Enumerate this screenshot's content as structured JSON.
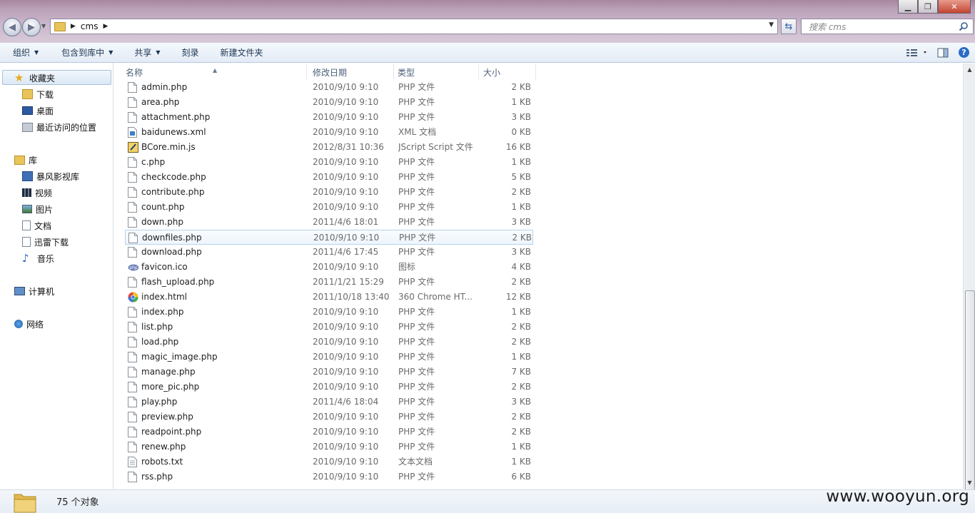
{
  "window": {
    "minimize": "▁",
    "maximize": "❐",
    "close": "✕"
  },
  "address": {
    "segment": "cms",
    "arrow": "▶"
  },
  "search": {
    "placeholder": "搜索 cms"
  },
  "toolbar": {
    "organize": "组织",
    "include_in_library": "包含到库中",
    "share": "共享",
    "burn": "刻录",
    "new_folder": "新建文件夹"
  },
  "nav": {
    "favorites": "收藏夹",
    "downloads": "下载",
    "desktop": "桌面",
    "recent": "最近访问的位置",
    "libraries": "库",
    "baofeng": "暴风影视库",
    "videos": "视频",
    "pictures": "图片",
    "documents": "文档",
    "xunlei": "迅雷下载",
    "music": "音乐",
    "computer": "计算机",
    "network": "网络"
  },
  "columns": {
    "name": "名称",
    "date": "修改日期",
    "type": "类型",
    "size": "大小"
  },
  "files": [
    {
      "name": "admin.php",
      "date": "2010/9/10 9:10",
      "type": "PHP 文件",
      "size": "2 KB",
      "icon": "php"
    },
    {
      "name": "area.php",
      "date": "2010/9/10 9:10",
      "type": "PHP 文件",
      "size": "1 KB",
      "icon": "php"
    },
    {
      "name": "attachment.php",
      "date": "2010/9/10 9:10",
      "type": "PHP 文件",
      "size": "3 KB",
      "icon": "php"
    },
    {
      "name": "baidunews.xml",
      "date": "2010/9/10 9:10",
      "type": "XML 文档",
      "size": "0 KB",
      "icon": "xml"
    },
    {
      "name": "BCore.min.js",
      "date": "2012/8/31 10:36",
      "type": "JScript Script 文件",
      "size": "16 KB",
      "icon": "js"
    },
    {
      "name": "c.php",
      "date": "2010/9/10 9:10",
      "type": "PHP 文件",
      "size": "1 KB",
      "icon": "php"
    },
    {
      "name": "checkcode.php",
      "date": "2010/9/10 9:10",
      "type": "PHP 文件",
      "size": "5 KB",
      "icon": "php"
    },
    {
      "name": "contribute.php",
      "date": "2010/9/10 9:10",
      "type": "PHP 文件",
      "size": "2 KB",
      "icon": "php"
    },
    {
      "name": "count.php",
      "date": "2010/9/10 9:10",
      "type": "PHP 文件",
      "size": "1 KB",
      "icon": "php"
    },
    {
      "name": "down.php",
      "date": "2011/4/6 18:01",
      "type": "PHP 文件",
      "size": "3 KB",
      "icon": "php"
    },
    {
      "name": "downfiles.php",
      "date": "2010/9/10 9:10",
      "type": "PHP 文件",
      "size": "2 KB",
      "icon": "php",
      "selected": true
    },
    {
      "name": "download.php",
      "date": "2011/4/6 17:45",
      "type": "PHP 文件",
      "size": "3 KB",
      "icon": "php"
    },
    {
      "name": "favicon.ico",
      "date": "2010/9/10 9:10",
      "type": "图标",
      "size": "4 KB",
      "icon": "ico"
    },
    {
      "name": "flash_upload.php",
      "date": "2011/1/21 15:29",
      "type": "PHP 文件",
      "size": "2 KB",
      "icon": "php"
    },
    {
      "name": "index.html",
      "date": "2011/10/18 13:40",
      "type": "360 Chrome HT...",
      "size": "12 KB",
      "icon": "html"
    },
    {
      "name": "index.php",
      "date": "2010/9/10 9:10",
      "type": "PHP 文件",
      "size": "1 KB",
      "icon": "php"
    },
    {
      "name": "list.php",
      "date": "2010/9/10 9:10",
      "type": "PHP 文件",
      "size": "2 KB",
      "icon": "php"
    },
    {
      "name": "load.php",
      "date": "2010/9/10 9:10",
      "type": "PHP 文件",
      "size": "2 KB",
      "icon": "php"
    },
    {
      "name": "magic_image.php",
      "date": "2010/9/10 9:10",
      "type": "PHP 文件",
      "size": "1 KB",
      "icon": "php"
    },
    {
      "name": "manage.php",
      "date": "2010/9/10 9:10",
      "type": "PHP 文件",
      "size": "7 KB",
      "icon": "php"
    },
    {
      "name": "more_pic.php",
      "date": "2010/9/10 9:10",
      "type": "PHP 文件",
      "size": "2 KB",
      "icon": "php"
    },
    {
      "name": "play.php",
      "date": "2011/4/6 18:04",
      "type": "PHP 文件",
      "size": "3 KB",
      "icon": "php"
    },
    {
      "name": "preview.php",
      "date": "2010/9/10 9:10",
      "type": "PHP 文件",
      "size": "2 KB",
      "icon": "php"
    },
    {
      "name": "readpoint.php",
      "date": "2010/9/10 9:10",
      "type": "PHP 文件",
      "size": "2 KB",
      "icon": "php"
    },
    {
      "name": "renew.php",
      "date": "2010/9/10 9:10",
      "type": "PHP 文件",
      "size": "1 KB",
      "icon": "php"
    },
    {
      "name": "robots.txt",
      "date": "2010/9/10 9:10",
      "type": "文本文档",
      "size": "1 KB",
      "icon": "txt"
    },
    {
      "name": "rss.php",
      "date": "2010/9/10 9:10",
      "type": "PHP 文件",
      "size": "6 KB",
      "icon": "php"
    }
  ],
  "status": {
    "count": "75 个对象"
  },
  "watermark": "www.wooyun.org"
}
